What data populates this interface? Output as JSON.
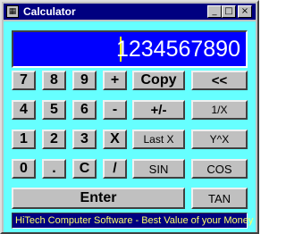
{
  "window": {
    "title": "Calculator",
    "icon": "calculator-icon",
    "controls": {
      "minimize": "_",
      "maximize": "□",
      "close": "×"
    }
  },
  "display": {
    "value": "1234567890"
  },
  "keys": {
    "seven": "7",
    "eight": "8",
    "nine": "9",
    "plus": "+",
    "copy": "Copy",
    "backspace": "<<",
    "four": "4",
    "five": "5",
    "six": "6",
    "minus": "-",
    "sign": "+/-",
    "reciprocal": "1/X",
    "one": "1",
    "two": "2",
    "three": "3",
    "multiply": "X",
    "last_x": "Last X",
    "power": "Y^X",
    "zero": "0",
    "decimal": ".",
    "clear": "C",
    "divide": "/",
    "sin": "SIN",
    "cos": "COS",
    "enter": "Enter",
    "tan": "TAN"
  },
  "status": {
    "text": "HiTech Computer Software - Best Value of your Money"
  },
  "colors": {
    "titlebar": "#000080",
    "client_bg": "#66ffff",
    "display_bg": "#0000ff",
    "display_text": "#ffffff",
    "caret": "#ffff00",
    "status_bg": "#000080",
    "status_text": "#ffff66"
  }
}
